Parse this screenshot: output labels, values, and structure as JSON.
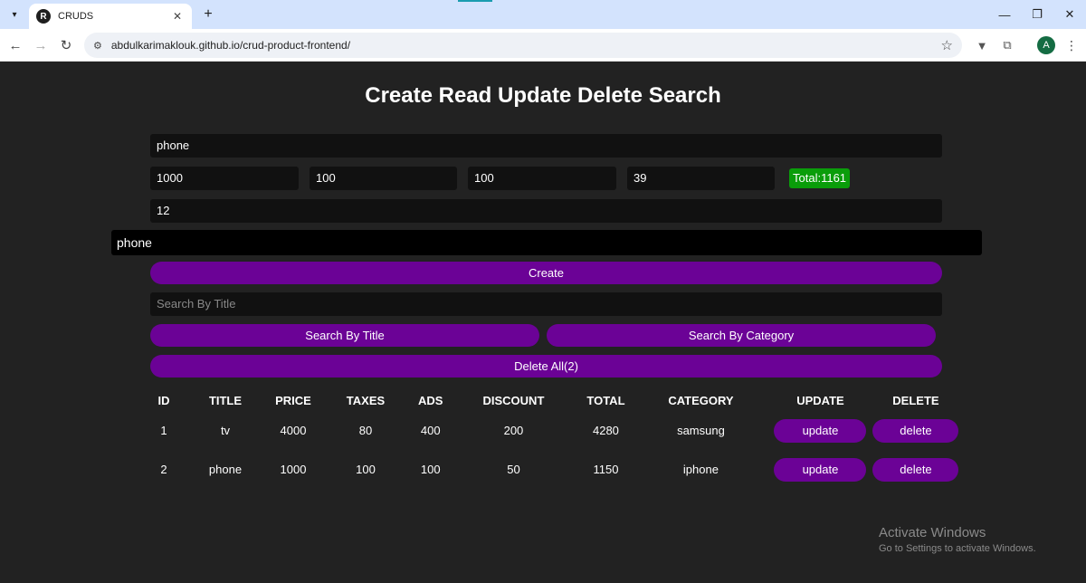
{
  "browser": {
    "tab_title": "CRUDS",
    "tab_favicon": "R",
    "url": "abdulkarimaklouk.github.io/crud-product-frontend/",
    "avatar_letter": "A",
    "icons": [
      "tab-list-icon",
      "close-icon",
      "plus-icon",
      "minimize-icon",
      "maximize-icon",
      "close-window-icon",
      "back-arrow-icon",
      "forward-arrow-icon",
      "reload-icon",
      "site-info-icon",
      "star-icon",
      "extension-icon",
      "puzzle-icon",
      "more-menu-icon"
    ]
  },
  "page": {
    "title": "Create Read Update Delete Search",
    "form": {
      "title_value": "phone",
      "price_value": "1000",
      "taxes_value": "100",
      "ads_value": "100",
      "discount_value": "39",
      "total_label": "Total:1161",
      "count_value": "12",
      "category_value": "phone",
      "create_label": "Create"
    },
    "search": {
      "placeholder": "Search By Title",
      "by_title_label": "Search By Title",
      "by_category_label": "Search By Category"
    },
    "delete_all_label": "Delete All(2)",
    "table": {
      "headers": [
        "ID",
        "TITLE",
        "PRICE",
        "TAXES",
        "ADS",
        "DISCOUNT",
        "TOTAL",
        "CATEGORY",
        "UPDATE",
        "DELETE"
      ],
      "rows": [
        {
          "id": "1",
          "title": "tv",
          "price": "4000",
          "taxes": "80",
          "ads": "400",
          "discount": "200",
          "total": "4280",
          "category": "samsung",
          "update": "update",
          "delete": "delete"
        },
        {
          "id": "2",
          "title": "phone",
          "price": "1000",
          "taxes": "100",
          "ads": "100",
          "discount": "50",
          "total": "1150",
          "category": "iphone",
          "update": "update",
          "delete": "delete"
        }
      ]
    },
    "colors": {
      "background": "#222222",
      "button": "#6b0296",
      "total_badge": "#0a9d0a",
      "input": "#111111"
    }
  },
  "watermark": {
    "title": "Activate Windows",
    "subtitle": "Go to Settings to activate Windows."
  }
}
